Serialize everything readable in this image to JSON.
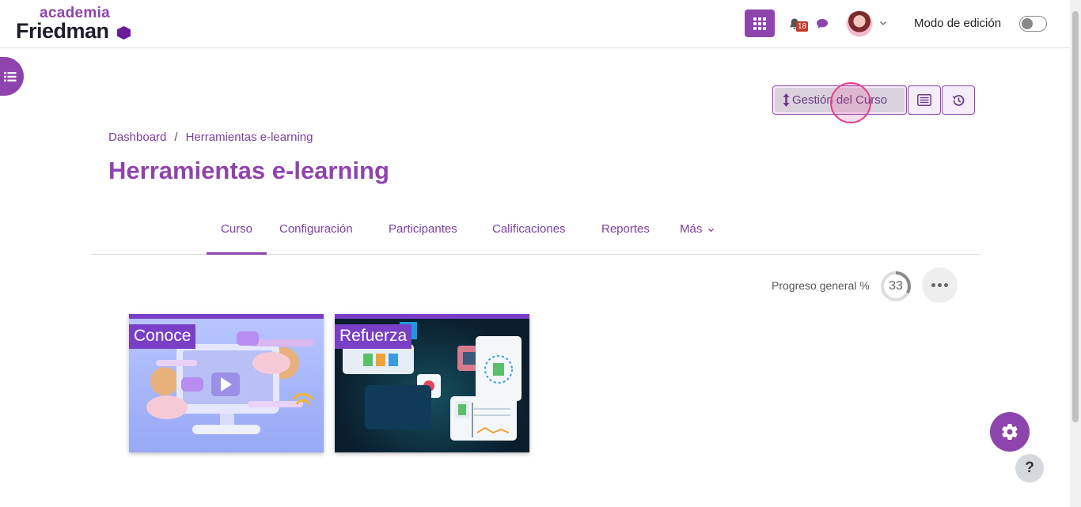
{
  "logo": {
    "top": "academia",
    "bottom": "Friedman"
  },
  "header": {
    "notifications_count": "18",
    "edit_mode_label": "Modo de edición"
  },
  "course_actions": {
    "manage_label": "Gestión del Curso"
  },
  "breadcrumb": {
    "items": [
      "Dashboard",
      "Herramientas e-learning"
    ],
    "separator": "/"
  },
  "page": {
    "title": "Herramientas e-learning"
  },
  "tabs": [
    {
      "label": "Curso",
      "active": true
    },
    {
      "label": "Configuración"
    },
    {
      "label": "Participantes"
    },
    {
      "label": "Calificaciones"
    },
    {
      "label": "Reportes"
    },
    {
      "label": "Más"
    }
  ],
  "progress": {
    "label": "Progreso general %",
    "value": "33",
    "fraction": 0.33
  },
  "cards": [
    {
      "label": "Conoce"
    },
    {
      "label": "Refuerza"
    }
  ],
  "help": {
    "label": "?"
  },
  "colors": {
    "accent": "#8e44ad",
    "card_label": "#7a3fc7",
    "badge": "#c0392b"
  },
  "icons": {
    "drawer": "list-icon",
    "apps": "grid-icon",
    "notifications": "bell-icon",
    "messages": "chat-icon",
    "manage": "sort-vertical-icon",
    "outline": "list-box-icon",
    "history": "history-icon",
    "more": "ellipsis-icon",
    "settings": "gear-icon"
  }
}
